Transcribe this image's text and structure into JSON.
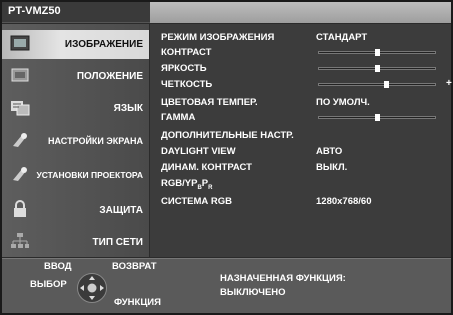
{
  "header": {
    "model": "PT-VMZ50"
  },
  "sidebar": {
    "items": [
      {
        "label": "ИЗОБРАЖЕНИЕ",
        "icon": "picture-icon",
        "active": true
      },
      {
        "label": "ПОЛОЖЕНИЕ",
        "icon": "position-icon",
        "active": false
      },
      {
        "label": "ЯЗЫК",
        "icon": "language-icon",
        "active": false
      },
      {
        "label": "НАСТРОЙКИ ЭКРАНА",
        "icon": "display-settings-icon",
        "active": false
      },
      {
        "label": "УСТАНОВКИ ПРОЕКТОРА",
        "icon": "projector-settings-icon",
        "active": false
      },
      {
        "label": "ЗАЩИТА",
        "icon": "lock-icon",
        "active": false
      },
      {
        "label": "ТИП СЕТИ",
        "icon": "network-icon",
        "active": false
      }
    ]
  },
  "menu": {
    "rows": [
      {
        "name": "РЕЖИМ ИЗОБРАЖЕНИЯ",
        "value": "СТАНДАРТ"
      },
      {
        "name": "КОНТРАСТ",
        "slider": 0.5
      },
      {
        "name": "ЯРКОСТЬ",
        "slider": 0.5
      },
      {
        "name": "ЧЕТКОСТЬ",
        "slider": 0.58,
        "plus": "+"
      },
      {
        "name": "ЦВЕТОВАЯ ТЕМПЕР.",
        "value": "ПО УМОЛЧ."
      },
      {
        "name": "ГАММА",
        "slider": 0.5
      },
      {
        "name": "ДОПОЛНИТЕЛЬНЫЕ НАСТР."
      },
      {
        "name": "DAYLIGHT VIEW",
        "value": "АВТО"
      },
      {
        "name": "ДИНАМ. КОНТРАСТ",
        "value": "ВЫКЛ."
      },
      {
        "name_main": "RGB/YP",
        "name_sub1": "B",
        "name_mid": "P",
        "name_sub2": "R"
      },
      {
        "name": "СИСТЕМА RGB",
        "value": "1280x768/60"
      }
    ]
  },
  "footer": {
    "enter": "ВВОД",
    "select": "ВЫБОР",
    "back": "ВОЗВРАТ",
    "function": "ФУНКЦИЯ",
    "assigned_label": "НАЗНАЧЕННАЯ ФУНКЦИЯ:",
    "assigned_value": "ВЫКЛЮЧЕНО"
  }
}
